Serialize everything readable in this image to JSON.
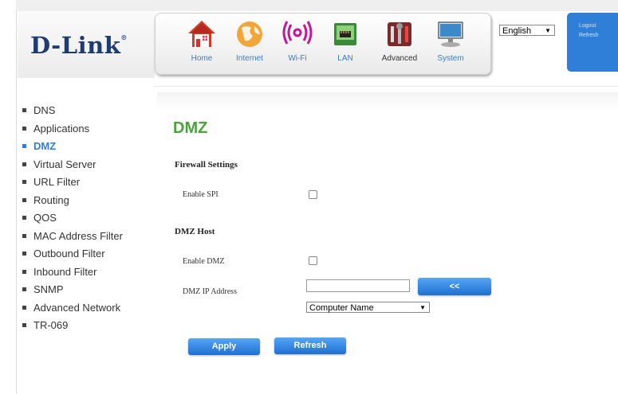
{
  "header": {
    "logo_text": "D-Link",
    "logo_mark": "®",
    "nav": [
      {
        "label": "Home",
        "icon": "home-icon"
      },
      {
        "label": "Internet",
        "icon": "globe-icon"
      },
      {
        "label": "Wi-Fi",
        "icon": "wifi-icon"
      },
      {
        "label": "LAN",
        "icon": "lan-icon"
      },
      {
        "label": "Advanced",
        "icon": "tools-icon"
      },
      {
        "label": "System",
        "icon": "computer-icon"
      }
    ],
    "active_nav": "Advanced",
    "language": "English",
    "logout": "Logout",
    "refresh": "Refresh"
  },
  "menu": {
    "items": [
      "DNS",
      "Applications",
      "DMZ",
      "Virtual Server",
      "URL Filter",
      "Routing",
      "QOS",
      "MAC Address Filter",
      "Outbound Filter",
      "Inbound Filter",
      "SNMP",
      "Advanced Network",
      "TR-069"
    ],
    "active": "DMZ"
  },
  "page": {
    "title": "DMZ",
    "firewall_section": "Firewall Settings",
    "enable_spi_label": "Enable SPI",
    "enable_spi_checked": false,
    "dmz_host_section": "DMZ Host",
    "enable_dmz_label": "Enable DMZ",
    "enable_dmz_checked": false,
    "dmz_ip_label": "DMZ IP Address",
    "dmz_ip_value": "",
    "copy_button": "<<",
    "computer_select": "Computer Name",
    "apply_button": "Apply",
    "refresh_button": "Refresh"
  },
  "colors": {
    "accent": "#2f7ed8",
    "title_green": "#4aa23a",
    "logo_blue": "#1f3c72"
  }
}
